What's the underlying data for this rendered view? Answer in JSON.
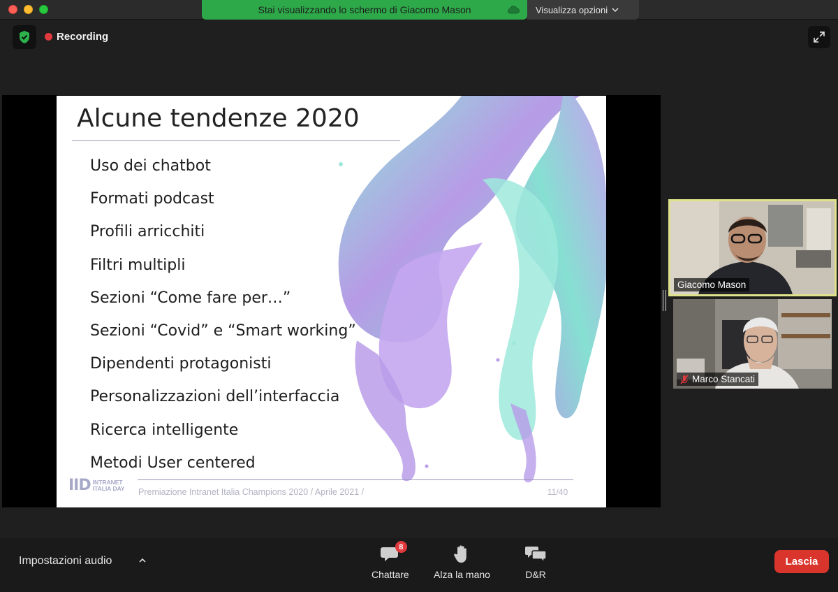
{
  "share_banner": {
    "text": "Stai visualizzando lo schermo di Giacomo Mason",
    "view_options": "Visualizza opzioni"
  },
  "meeting": {
    "recording_label": "Recording"
  },
  "slide": {
    "title": "Alcune tendenze 2020",
    "items": [
      "Uso dei chatbot",
      "Formati podcast",
      "Profili arricchiti",
      "Filtri multipli",
      "Sezioni “Come fare per…”",
      "Sezioni “Covid” e “Smart working”",
      "Dipendenti protagonisti",
      "Personalizzazioni dell’interfaccia",
      "Ricerca intelligente",
      "Metodi User centered"
    ],
    "logo_mark": "IID",
    "logo_text_line1": "INTRANET",
    "logo_text_line2": "ITALIA DAY",
    "footer": "Premiazione Intranet Italia Champions 2020 / Aprile 2021 /",
    "page": "11/40"
  },
  "participants": [
    {
      "name": "Giacomo Mason",
      "active_speaker": true,
      "muted": false
    },
    {
      "name": "Marco Stancati",
      "active_speaker": false,
      "muted": true
    }
  ],
  "toolbar": {
    "audio_settings": "Impostazioni audio",
    "chat_label": "Chattare",
    "chat_badge": "8",
    "raise_hand_label": "Alza la mano",
    "qa_label": "D&R",
    "leave_label": "Lascia"
  },
  "colors": {
    "banner_green": "#2ea94a",
    "leave_red": "#d9352d",
    "active_speaker_border": "#dfe28a"
  }
}
